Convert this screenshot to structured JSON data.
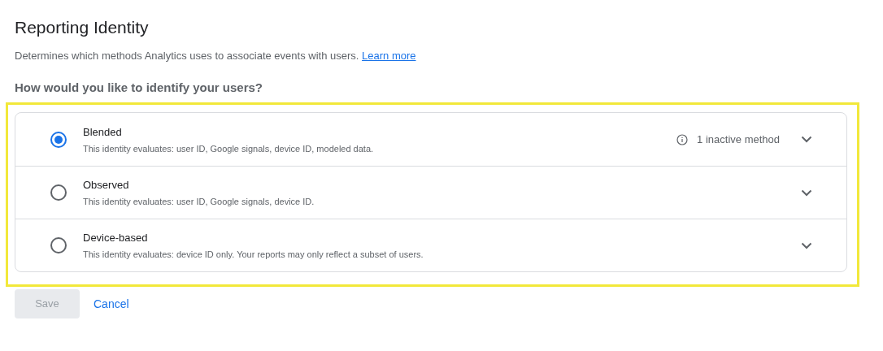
{
  "title": "Reporting Identity",
  "description": {
    "text": "Determines which methods Analytics uses to associate events with users.",
    "link": "Learn more"
  },
  "question": "How would you like to identify your users?",
  "options": [
    {
      "label": "Blended",
      "detail": "This identity evaluates: user ID, Google signals, device ID, modeled data.",
      "selected": true,
      "expanded": false,
      "note": "1 inactive method"
    },
    {
      "label": "Observed",
      "detail": "This identity evaluates: user ID, Google signals, device ID.",
      "selected": false,
      "expanded": false
    },
    {
      "label": "Device-based",
      "detail": "This identity evaluates: device ID only. Your reports may only reflect a subset of users.",
      "selected": false,
      "expanded": false
    }
  ],
  "buttons": [
    {
      "label": "Save",
      "kind": "primary",
      "disabled": true
    },
    {
      "label": "Cancel",
      "kind": "text",
      "disabled": false
    }
  ]
}
